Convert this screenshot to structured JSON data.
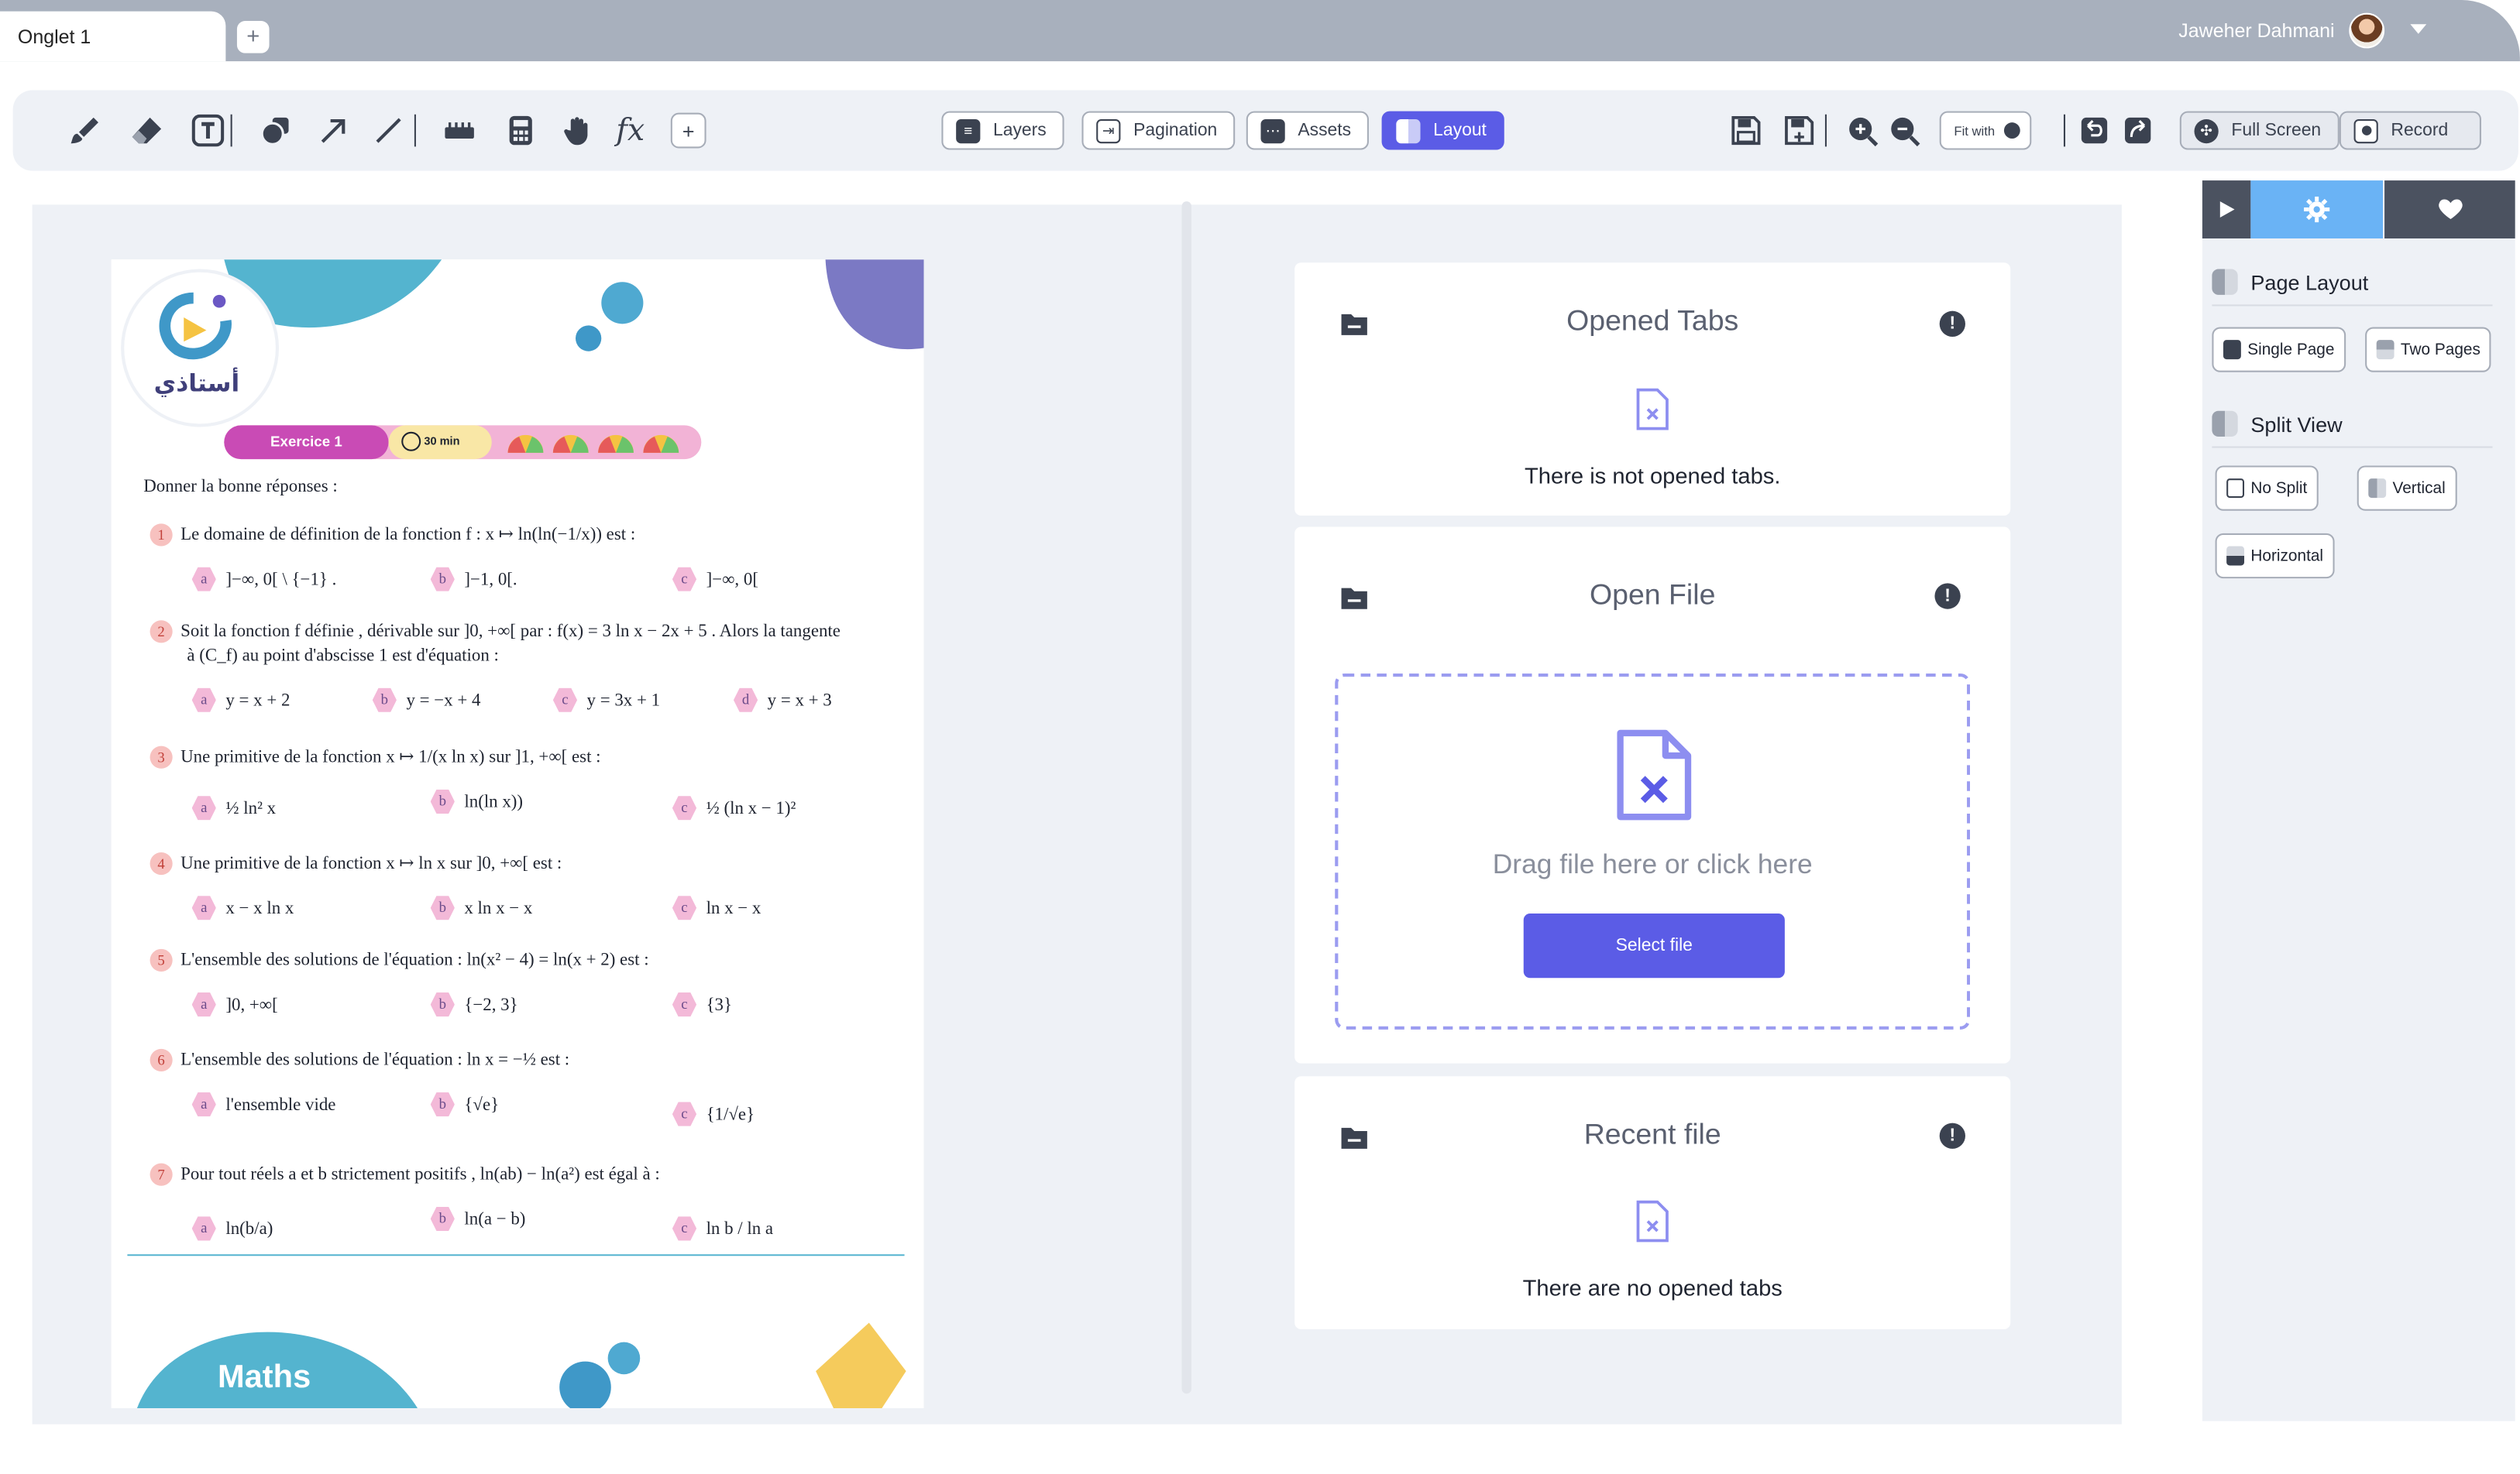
{
  "tabs": {
    "active_label": "Onglet 1",
    "add_label": "+"
  },
  "user": {
    "name": "Jaweher Dahmani"
  },
  "toolbar": {
    "layers": "Layers",
    "pagination": "Pagination",
    "assets": "Assets",
    "layout": "Layout",
    "fit_with": "Fit with",
    "full_screen": "Full Screen",
    "record": "Record",
    "add": "+",
    "fx": "fx"
  },
  "document": {
    "logo_text": "أستاذي",
    "exercise_badge": "Exercice 1",
    "duration": "30 min",
    "intro": "Donner la bonne réponses :",
    "questions": [
      {
        "n": "1",
        "text": "Le domaine de définition de la fonction f : x ↦ ln(ln(−1/x)) est :",
        "answers": [
          "]−∞, 0[ \\ {−1} .",
          "]−1, 0[.",
          "]−∞, 0["
        ]
      },
      {
        "n": "2",
        "text": "Soit la fonction f définie , dérivable sur ]0, +∞[ par : f(x) = 3 ln x − 2x + 5 . Alors la tangente",
        "text2": "à (C_f) au point d'abscisse 1 est d'équation :",
        "answers": [
          "y = x + 2",
          "y = −x + 4",
          "y = 3x + 1",
          "y = x + 3"
        ]
      },
      {
        "n": "3",
        "text": "Une primitive de la fonction x ↦ 1/(x ln x) sur ]1, +∞[ est :",
        "answers": [
          "½ ln² x",
          "ln(ln x))",
          "½ (ln x − 1)²"
        ]
      },
      {
        "n": "4",
        "text": "Une primitive de la fonction x ↦ ln x sur ]0, +∞[ est :",
        "answers": [
          "x − x ln x",
          "x ln x − x",
          "ln x − x"
        ]
      },
      {
        "n": "5",
        "text": "L'ensemble des solutions de l'équation : ln(x² − 4) = ln(x + 2) est :",
        "answers": [
          "]0, +∞[",
          "{−2, 3}",
          "{3}"
        ]
      },
      {
        "n": "6",
        "text": "L'ensemble des solutions de l'équation : ln x = −½ est :",
        "answers": [
          "l'ensemble vide",
          "{√e}",
          "{1/√e}"
        ]
      },
      {
        "n": "7",
        "text": "Pour tout réels a et b strictement positifs , ln(ab) − ln(a²) est égal à :",
        "answers": [
          "ln(b/a)",
          "ln(a − b)",
          "ln b / ln a"
        ]
      }
    ],
    "footer_subject": "Maths"
  },
  "cards": {
    "opened_tabs": {
      "title": "Opened Tabs",
      "message": "There is not opened tabs."
    },
    "open_file": {
      "title": "Open File",
      "drop_text": "Drag file here or click here",
      "button": "Select file"
    },
    "recent_file": {
      "title": "Recent file",
      "message": "There are no opened tabs"
    }
  },
  "right_panel": {
    "page_layout": "Page Layout",
    "single_page": "Single Page",
    "two_pages": "Two Pages",
    "split_view": "Split View",
    "no_split": "No Split",
    "vertical": "Vertical",
    "horizontal": "Horizontal"
  },
  "colors": {
    "accent": "#5b5ce6",
    "tab_strip": "#a8b0bd",
    "panel_bg": "#eef1f6",
    "active_tab_blue": "#6ab3f5",
    "dark_tab": "#4b5260"
  }
}
